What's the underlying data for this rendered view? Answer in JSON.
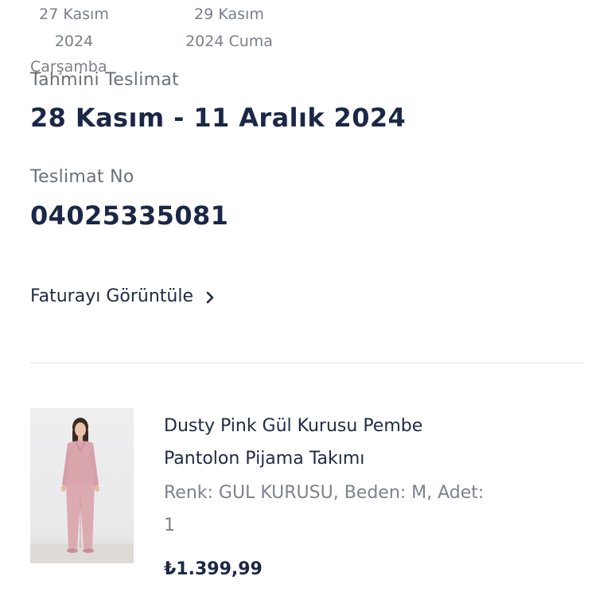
{
  "timeline": {
    "dates": [
      {
        "line1": "27 Kasım",
        "line2": "2024"
      },
      {
        "line1": "29 Kasım",
        "line2": "2024 Cuma"
      }
    ],
    "extra": "Çarşamba"
  },
  "delivery": {
    "label": "Tahmini Teslimat",
    "value": "28 Kasım - 11 Aralık 2024"
  },
  "shipment": {
    "label": "Teslimat No",
    "value": "04025335081"
  },
  "invoice": {
    "link_label": "Faturayı Görüntüle",
    "icon": "chevron-right-icon"
  },
  "product": {
    "name": "Dusty Pink Gül Kurusu Pembe Pantolon Pijama Takımı",
    "attributes": "Renk: GUL KURUSU, Beden: M, Adet: 1",
    "price": "₺1.399,99",
    "image_icon": "product-image"
  },
  "colors": {
    "primary_text": "#1b2746",
    "secondary_text": "#6c707a",
    "divider": "#eef0f4"
  }
}
